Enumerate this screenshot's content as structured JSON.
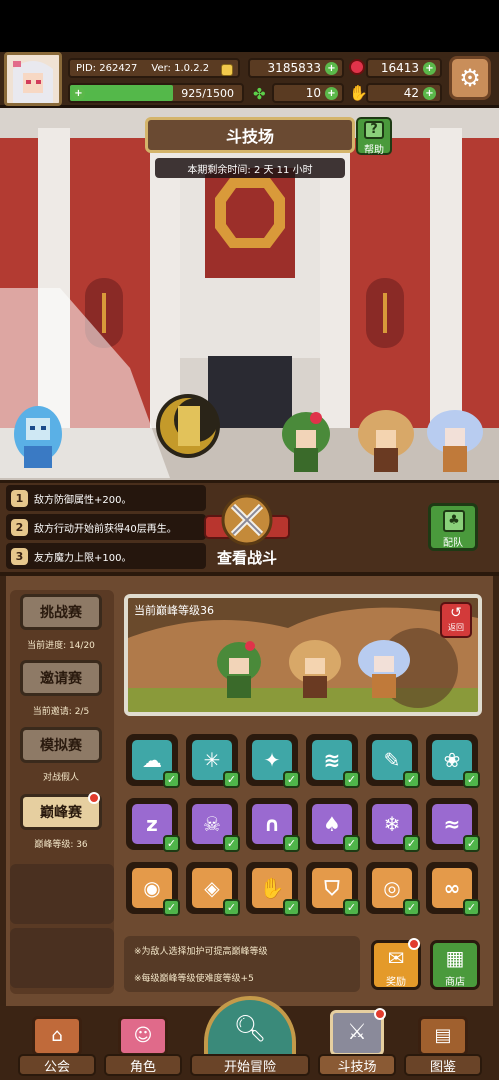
{
  "header": {
    "pid": "PID: 262427",
    "version": "Ver: 1.0.2.2",
    "xp": "925/1500",
    "xp_fraction": 0.617,
    "gold": "3185833",
    "gems": "16413",
    "clover": "10",
    "hand": "42"
  },
  "arena": {
    "title": "斗技场",
    "timer": "本期剩余时间: 2 天 11 小时",
    "help_label": "帮助"
  },
  "buffs": [
    {
      "num": "1",
      "text": "敌方防御属性+200。"
    },
    {
      "num": "2",
      "text": "敌方行动开始前获得40层再生。"
    },
    {
      "num": "3",
      "text": "友方魔力上限+100。"
    }
  ],
  "view_battle_label": "查看战斗",
  "team_label": "配队",
  "sidebar": [
    {
      "label": "挑战赛",
      "sub": "当前进度: 14/20"
    },
    {
      "label": "邀请赛",
      "sub": "当前邀请: 2/5"
    },
    {
      "label": "模拟赛",
      "sub": "对战假人"
    },
    {
      "label": "巅峰赛",
      "sub": "巅峰等级: 36"
    }
  ],
  "preview": {
    "title": "当前巅峰等级36",
    "back_label": "返回"
  },
  "skills": [
    {
      "icon": "cloud-icon",
      "glyph": "☁",
      "color": "#3fa7a7"
    },
    {
      "icon": "snowflake-ring-icon",
      "glyph": "✳",
      "color": "#3fa7a7"
    },
    {
      "icon": "sparkle-icon",
      "glyph": "✦",
      "color": "#3fa7a7"
    },
    {
      "icon": "tornado-icon",
      "glyph": "≋",
      "color": "#3fa7a7"
    },
    {
      "icon": "feather-icon",
      "glyph": "✎",
      "color": "#3fa7a7"
    },
    {
      "icon": "paw-icon",
      "glyph": "❀",
      "color": "#3fa7a7"
    },
    {
      "icon": "sleep-icon",
      "glyph": "z",
      "color": "#9a6ad0"
    },
    {
      "icon": "skull-icon",
      "glyph": "☠",
      "color": "#9a6ad0"
    },
    {
      "icon": "tombstone-icon",
      "glyph": "∩",
      "color": "#9a6ad0"
    },
    {
      "icon": "mushroom-icon",
      "glyph": "♠",
      "color": "#9a6ad0"
    },
    {
      "icon": "frost-icon",
      "glyph": "❄",
      "color": "#9a6ad0"
    },
    {
      "icon": "wind-icon",
      "glyph": "≈",
      "color": "#9a6ad0"
    },
    {
      "icon": "shell-icon",
      "glyph": "◉",
      "color": "#e49a4a"
    },
    {
      "icon": "gem-shield-icon",
      "glyph": "◈",
      "color": "#e49a4a"
    },
    {
      "icon": "claw-icon",
      "glyph": "✋",
      "color": "#e49a4a"
    },
    {
      "icon": "shield-icon",
      "glyph": "⛉",
      "color": "#e49a4a"
    },
    {
      "icon": "spiral-icon",
      "glyph": "◎",
      "color": "#e49a4a"
    },
    {
      "icon": "infinity-icon",
      "glyph": "∞",
      "color": "#e49a4a"
    }
  ],
  "tips": [
    "※为敌人选择加护可提高巅峰等级",
    "※每级巅峰等级使难度等级+5"
  ],
  "reward_label": "奖励",
  "shop_label": "商店",
  "nav": [
    {
      "label": "公会"
    },
    {
      "label": "角色"
    },
    {
      "label": "开始冒险"
    },
    {
      "label": "斗技场"
    },
    {
      "label": "图鉴"
    }
  ]
}
